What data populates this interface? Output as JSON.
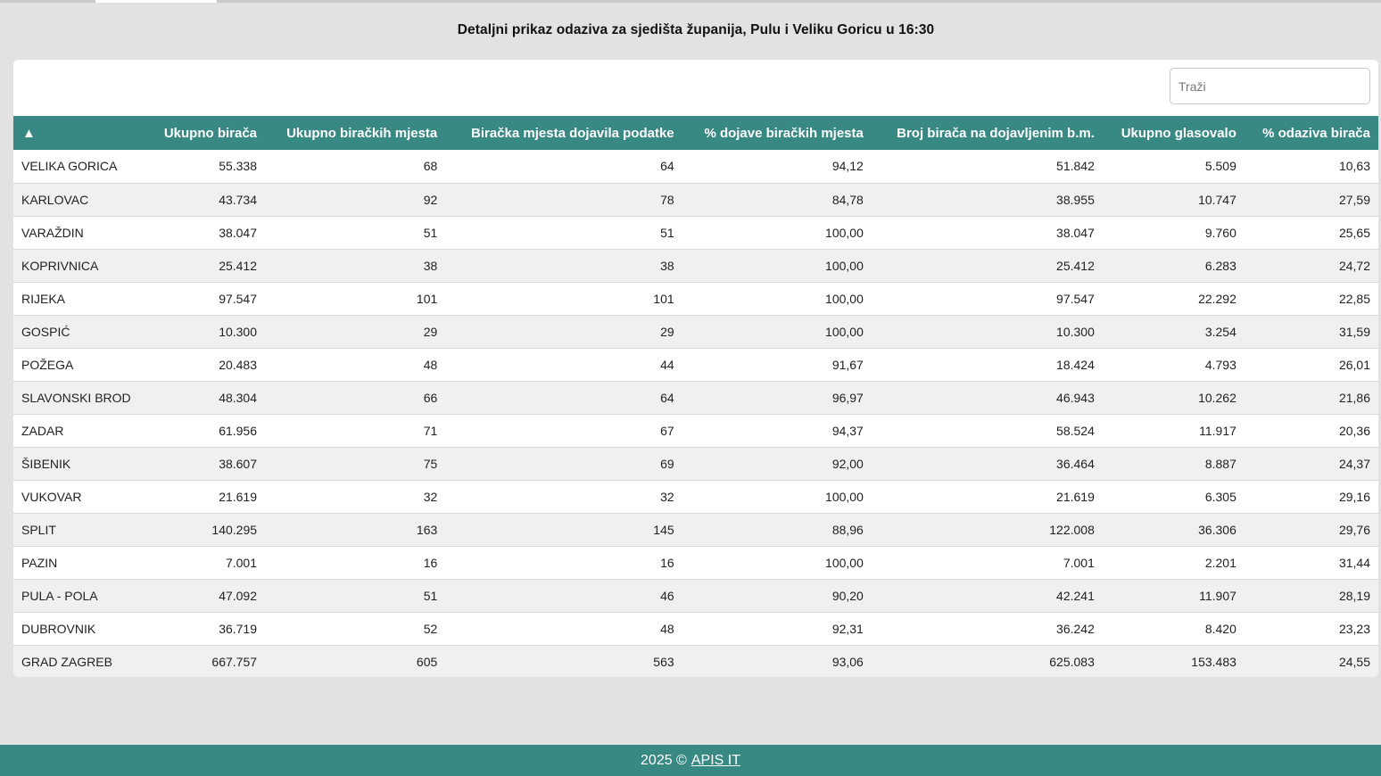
{
  "page": {
    "title": "Detaljni prikaz odaziva za sjedišta županija, Pulu i Veliku Goricu u 16:30"
  },
  "search": {
    "placeholder": "Traži"
  },
  "table": {
    "sort_indicator": "▲",
    "headers": [
      "",
      "Ukupno birača",
      "Ukupno biračkih mjesta",
      "Biračka mjesta dojavila podatke",
      "% dojave biračkih mjesta",
      "Broj birača na dojavljenim b.m.",
      "Ukupno glasovalo",
      "% odaziva birača"
    ],
    "rows": [
      [
        "VELIKA GORICA",
        "55.338",
        "68",
        "64",
        "94,12",
        "51.842",
        "5.509",
        "10,63"
      ],
      [
        "KARLOVAC",
        "43.734",
        "92",
        "78",
        "84,78",
        "38.955",
        "10.747",
        "27,59"
      ],
      [
        "VARAŽDIN",
        "38.047",
        "51",
        "51",
        "100,00",
        "38.047",
        "9.760",
        "25,65"
      ],
      [
        "KOPRIVNICA",
        "25.412",
        "38",
        "38",
        "100,00",
        "25.412",
        "6.283",
        "24,72"
      ],
      [
        "RIJEKA",
        "97.547",
        "101",
        "101",
        "100,00",
        "97.547",
        "22.292",
        "22,85"
      ],
      [
        "GOSPIĆ",
        "10.300",
        "29",
        "29",
        "100,00",
        "10.300",
        "3.254",
        "31,59"
      ],
      [
        "POŽEGA",
        "20.483",
        "48",
        "44",
        "91,67",
        "18.424",
        "4.793",
        "26,01"
      ],
      [
        "SLAVONSKI BROD",
        "48.304",
        "66",
        "64",
        "96,97",
        "46.943",
        "10.262",
        "21,86"
      ],
      [
        "ZADAR",
        "61.956",
        "71",
        "67",
        "94,37",
        "58.524",
        "11.917",
        "20,36"
      ],
      [
        "ŠIBENIK",
        "38.607",
        "75",
        "69",
        "92,00",
        "36.464",
        "8.887",
        "24,37"
      ],
      [
        "VUKOVAR",
        "21.619",
        "32",
        "32",
        "100,00",
        "21.619",
        "6.305",
        "29,16"
      ],
      [
        "SPLIT",
        "140.295",
        "163",
        "145",
        "88,96",
        "122.008",
        "36.306",
        "29,76"
      ],
      [
        "PAZIN",
        "7.001",
        "16",
        "16",
        "100,00",
        "7.001",
        "2.201",
        "31,44"
      ],
      [
        "PULA - POLA",
        "47.092",
        "51",
        "46",
        "90,20",
        "42.241",
        "11.907",
        "28,19"
      ],
      [
        "DUBROVNIK",
        "36.719",
        "52",
        "48",
        "92,31",
        "36.242",
        "8.420",
        "23,23"
      ],
      [
        "GRAD ZAGREB",
        "667.757",
        "605",
        "563",
        "93,06",
        "625.083",
        "153.483",
        "24,55"
      ]
    ]
  },
  "footer": {
    "copyright": "2025 ©",
    "link_text": "APIS IT"
  },
  "colors": {
    "accent": "#388884",
    "background": "#e2e2e2"
  }
}
